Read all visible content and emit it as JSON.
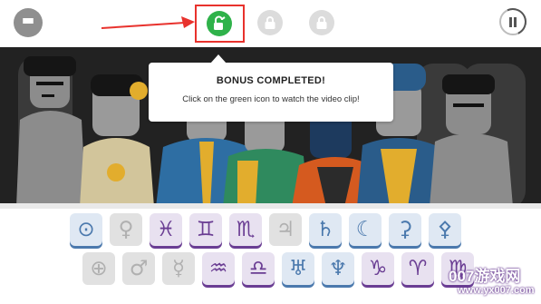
{
  "topbar": {
    "menu_icon": "hamburger-menu-icon",
    "bonus_icon": "bonus-unlocked-icon",
    "lock_icon": "padlock-icon",
    "pause_icon": "pause-icon"
  },
  "popup": {
    "title": "BONUS COMPLETED!",
    "message": "Click on the green icon to watch the video clip!"
  },
  "tray": {
    "row1": [
      {
        "symbol": "⊙",
        "style": "blue",
        "name": "sun"
      },
      {
        "symbol": "♀",
        "style": "off",
        "name": "venus"
      },
      {
        "symbol": "♓",
        "style": "purple",
        "name": "pisces"
      },
      {
        "symbol": "♊",
        "style": "purple",
        "name": "gemini"
      },
      {
        "symbol": "♏",
        "style": "purple",
        "name": "scorpio"
      },
      {
        "symbol": "♃",
        "style": "off",
        "name": "jupiter"
      },
      {
        "symbol": "♄",
        "style": "blue",
        "name": "saturn"
      },
      {
        "symbol": "☾",
        "style": "blue",
        "name": "moon"
      },
      {
        "symbol": "⚳",
        "style": "blue",
        "name": "ceres"
      },
      {
        "symbol": "⚴",
        "style": "blue",
        "name": "pallas"
      }
    ],
    "row2": [
      {
        "symbol": "⊕",
        "style": "off",
        "name": "earth"
      },
      {
        "symbol": "♂",
        "style": "off",
        "name": "mars"
      },
      {
        "symbol": "☿",
        "style": "off",
        "name": "mercury"
      },
      {
        "symbol": "♒",
        "style": "purple",
        "name": "aquarius"
      },
      {
        "symbol": "♎",
        "style": "purple",
        "name": "libra"
      },
      {
        "symbol": "♅",
        "style": "blue",
        "name": "uranus"
      },
      {
        "symbol": "♆",
        "style": "blue",
        "name": "neptune"
      },
      {
        "symbol": "♑",
        "style": "purple",
        "name": "capricorn"
      },
      {
        "symbol": "♈",
        "style": "purple",
        "name": "aries"
      },
      {
        "symbol": "♍",
        "style": "purple",
        "name": "virgo"
      }
    ]
  },
  "watermark": {
    "line1": "007游戏网",
    "line2": "www.yx007.com"
  },
  "colors": {
    "accent_green": "#2fb24a",
    "highlight_red": "#e8322d",
    "tile_blue": "#4b79ad",
    "tile_purple": "#6a3d93"
  }
}
